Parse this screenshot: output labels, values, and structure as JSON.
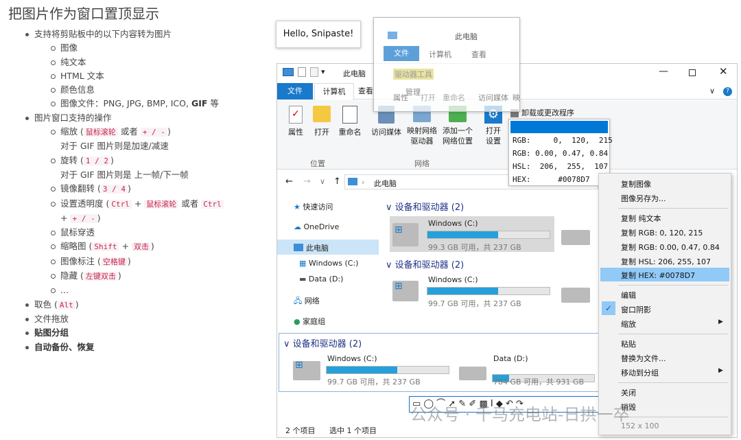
{
  "doc": {
    "title": "把图片作为窗口置顶显示",
    "items": [
      {
        "text": "支持将剪贴板中的以下内容转为图片"
      },
      {
        "text": "图像"
      },
      {
        "text": "纯文本"
      },
      {
        "text": "HTML 文本"
      },
      {
        "text": "颜色信息"
      },
      {
        "text": "图像文件：PNG, JPG, BMP, ICO, ",
        "bold": "GIF",
        "tail": " 等"
      },
      {
        "text": "图片窗口支持的操作"
      },
      {
        "pre": "缩放 (",
        "k1": "鼠标滚轮",
        "mid": " 或者 ",
        "k2": "+ / -",
        "post": ")",
        "line2": "对于 GIF 图片则是加速/减速"
      },
      {
        "pre": "旋转 (",
        "k1": "1 / 2",
        "post": ")",
        "line2": "对于 GIF 图片则是 上一帧/下一帧"
      },
      {
        "pre": "镜像翻转 (",
        "k1": "3 / 4",
        "post": ")"
      },
      {
        "pre": "设置透明度 (",
        "k1": "Ctrl",
        "mid": " + ",
        "k2": "鼠标滚轮",
        "mid2": " 或者 ",
        "k3": "Ctrl",
        "line2pre": "+ ",
        "line2k": "+ / -",
        "line2post": ")"
      },
      {
        "text": "鼠标穿透"
      },
      {
        "pre": "缩略图 (",
        "k1": "Shift",
        "mid": " + ",
        "k2": "双击",
        "post": ")"
      },
      {
        "pre": "图像标注 (",
        "k1": "空格键",
        "post": ")"
      },
      {
        "pre": "隐藏 (",
        "k1": "左键双击",
        "post": ")"
      },
      {
        "text": "..."
      },
      {
        "pre": "取色 (",
        "k1": "Alt",
        "post": ")"
      },
      {
        "text": "文件拖放"
      },
      {
        "text": "贴图分组"
      },
      {
        "text": "自动备份、恢复"
      }
    ]
  },
  "hello": "Hello, Snipaste!",
  "mini": {
    "title": "此电脑",
    "tab1": "文件",
    "tab2": "计算机",
    "tab3": "查看",
    "btn1": "属性",
    "btn2": "打开",
    "btn3": "重命名",
    "btn4": "访问媒体",
    "btn5": "映",
    "drv": "驱动器工具",
    "mng": "管理"
  },
  "explorer": {
    "title": "此电脑",
    "tabs": [
      "文件",
      "计算机",
      "查看"
    ],
    "ribbon": [
      "属性",
      "打开",
      "重命名",
      "访问媒体",
      "映射网络\n驱动器",
      "添加一个\n网络位置",
      "打开\n设置"
    ],
    "uninstall": "卸载或更改程序",
    "groups": [
      "位置",
      "网络"
    ],
    "address": "此电脑",
    "nav": [
      "快速访问",
      "OneDrive",
      "此电脑",
      "Windows (C:)",
      "Data (D:)",
      "网络",
      "家庭组"
    ],
    "section": "设备和驱动器 (2)",
    "drive_c": "Windows (C:)",
    "drive_c_free": "99.3 GB 可用，共 237 GB",
    "drive_c_free2": "99.7 GB 可用，共 237 GB",
    "drive_d": "Data (D:)",
    "drive_d_free": "784 GB 可用，共 931 GB",
    "status1": "2 个项目",
    "status2": "选中 1 个项目"
  },
  "color_info": {
    "swatch": "#0078D7",
    "rgb": "RGB:     0,  120,  215",
    "rgbf": "RGB: 0.00, 0.47, 0.84",
    "hsl": "HSL:  206,  255,  107",
    "hex": "HEX:      #0078D7"
  },
  "context_menu": {
    "items": [
      "复制图像",
      "图像另存为...",
      "复制 纯文本",
      "复制 RGB: 0, 120, 215",
      "复制 RGB: 0.00, 0.47, 0.84",
      "复制 HSL: 206, 255, 107",
      "复制 HEX: #0078D7",
      "编辑",
      "窗口阴影",
      "缩放",
      "粘贴",
      "替换为文件...",
      "移动到分组",
      "关闭",
      "销毁"
    ],
    "size": "152 x 100"
  },
  "watermark": "公众号 · 千马充电站-日拱一卒",
  "colors": {
    "accent": "#0078d7",
    "tab": "#1979ca",
    "drivebar": "#26a0da",
    "menu_hl": "#91c9f7"
  }
}
